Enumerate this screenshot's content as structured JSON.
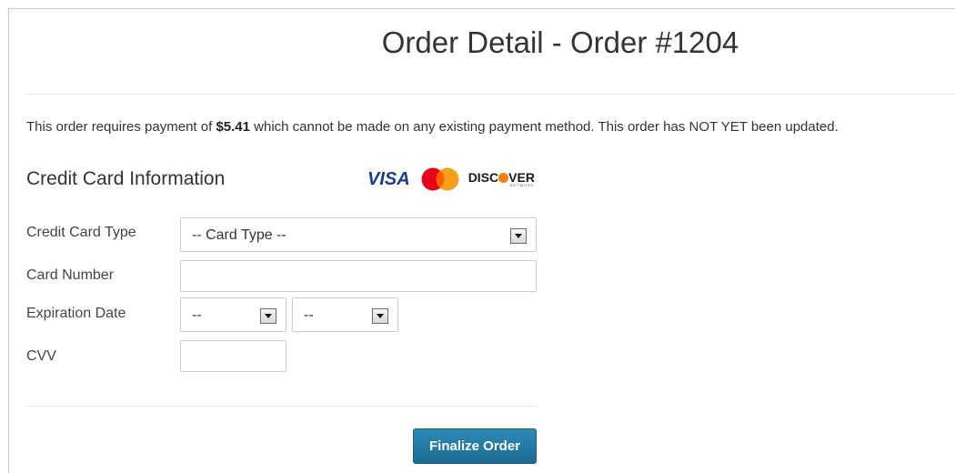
{
  "page": {
    "title": "Order Detail - Order #1204"
  },
  "notice": {
    "prefix": "This order requires payment of ",
    "amount": "$5.41",
    "suffix": " which cannot be made on any existing payment method. This order has NOT YET been updated."
  },
  "section": {
    "title": "Credit Card Information",
    "card_logos": [
      {
        "name": "VISA",
        "icon": "visa-logo"
      },
      {
        "name": "MasterCard",
        "icon": "mastercard-logo"
      },
      {
        "name": "DISCOVER",
        "icon": "discover-logo",
        "subtext": "NETWORK"
      }
    ]
  },
  "form": {
    "card_type": {
      "label": "Credit Card Type",
      "selected": "-- Card Type --"
    },
    "card_number": {
      "label": "Card Number",
      "value": ""
    },
    "expiration": {
      "label": "Expiration Date",
      "month_selected": "--",
      "year_selected": "--"
    },
    "cvv": {
      "label": "CVV",
      "value": ""
    }
  },
  "actions": {
    "finalize_label": "Finalize Order"
  },
  "colors": {
    "primary_button": "#1b6a92",
    "visa_blue": "#1a3d8f",
    "mc_red": "#eb001b",
    "mc_orange": "#f79e1b",
    "discover_orange": "#f07f13"
  }
}
